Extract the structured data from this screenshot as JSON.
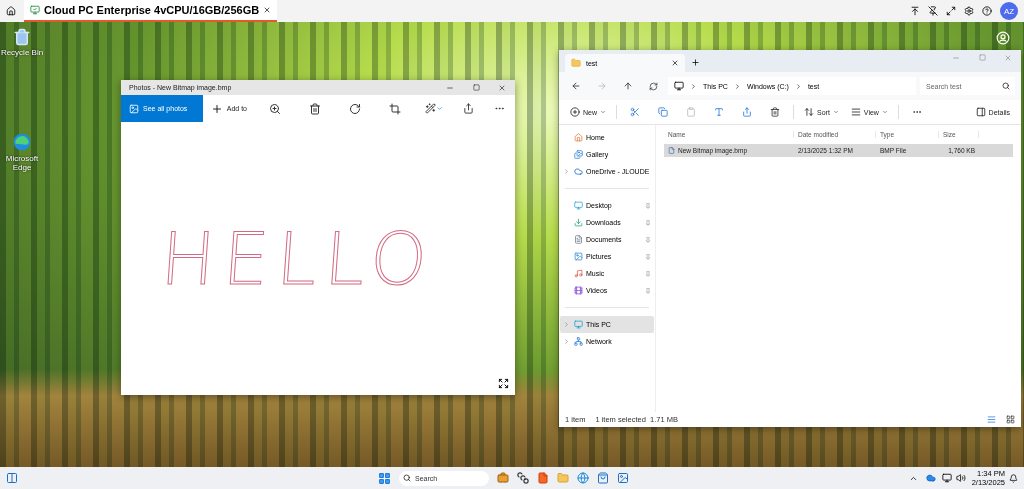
{
  "top_bar": {
    "tab": {
      "title": "Cloud PC Enterprise 4vCPU/16GB/256GB",
      "selected": true
    },
    "avatar": "AZ"
  },
  "desktop_icons": [
    {
      "label": "Recycle Bin",
      "kind": "recycle"
    },
    {
      "label": "Microsoft Edge",
      "kind": "edge"
    }
  ],
  "photos": {
    "title": "Photos - New Bitmap image.bmp",
    "toolbar": [
      {
        "label": "See all photos",
        "selected": true
      },
      {
        "label": "Add to",
        "selected": false
      }
    ],
    "canvas_text": "HELLO"
  },
  "explorer": {
    "tab": "test",
    "breadcrumb": [
      "This PC",
      "Windows (C:)",
      "test"
    ],
    "search": {
      "placeholder": "Search test"
    },
    "commands": [
      {
        "label": "New",
        "kind": "new"
      },
      {
        "label": "Sort",
        "kind": "sort"
      },
      {
        "label": "View",
        "kind": "view"
      }
    ],
    "details": "Details",
    "columns": [
      "Name",
      "Date modified",
      "Type",
      "Size"
    ],
    "rows": [
      {
        "cells": [
          "New Bitmap image.bmp",
          "2/13/2025 1:32 PM",
          "BMP File",
          "1,760 KB"
        ],
        "selected": true
      }
    ],
    "nav_groups": [
      [
        {
          "label": "Home",
          "kind": "home",
          "pinned": false,
          "expandable": false,
          "selected": false
        },
        {
          "label": "Gallery",
          "kind": "gallery",
          "pinned": false,
          "expandable": false,
          "selected": false
        },
        {
          "label": "OneDrive - JLOUDE",
          "kind": "cloud",
          "pinned": false,
          "expandable": true,
          "selected": false
        }
      ],
      [
        {
          "label": "Desktop",
          "kind": "desktop",
          "pinned": true,
          "expandable": false,
          "selected": false
        },
        {
          "label": "Downloads",
          "kind": "downloads",
          "pinned": true,
          "expandable": false,
          "selected": false
        },
        {
          "label": "Documents",
          "kind": "documents",
          "pinned": true,
          "expandable": false,
          "selected": false
        },
        {
          "label": "Pictures",
          "kind": "pictures",
          "pinned": true,
          "expandable": false,
          "selected": false
        },
        {
          "label": "Music",
          "kind": "music",
          "pinned": true,
          "expandable": false,
          "selected": false
        },
        {
          "label": "Videos",
          "kind": "videos",
          "pinned": true,
          "expandable": false,
          "selected": false
        }
      ],
      [
        {
          "label": "This PC",
          "kind": "pc",
          "pinned": false,
          "expandable": true,
          "selected": true
        },
        {
          "label": "Network",
          "kind": "network",
          "pinned": false,
          "expandable": true,
          "selected": false
        }
      ]
    ],
    "status": [
      "1 item",
      "1 item selected  1.71 MB"
    ]
  },
  "taskbar": {
    "search": {
      "placeholder": "Search"
    },
    "time": "1:34 PM",
    "date": "2/13/2025"
  }
}
